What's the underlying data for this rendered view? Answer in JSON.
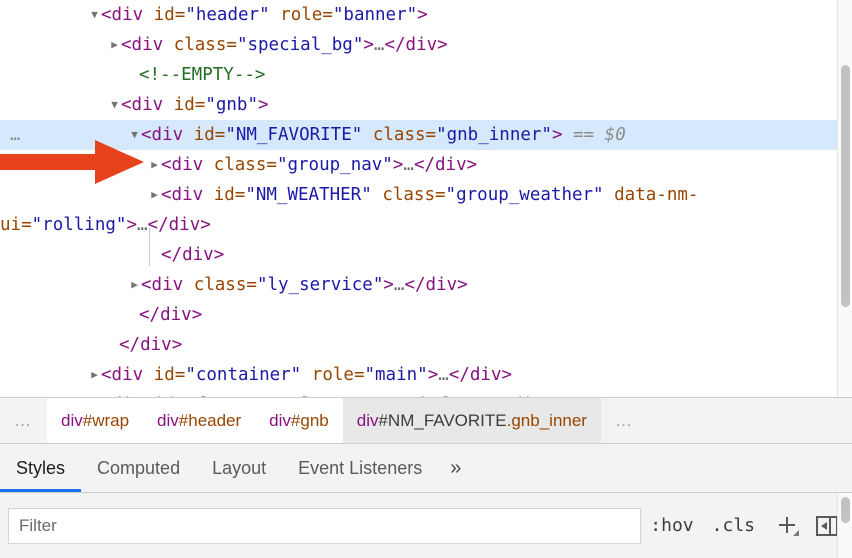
{
  "dom_tree": {
    "rows": [
      {
        "id": "header",
        "indent": 88,
        "twisty": "open",
        "parts": [
          {
            "t": "angle",
            "v": "<"
          },
          {
            "t": "tag",
            "v": "div"
          },
          {
            "t": "space",
            "v": " "
          },
          {
            "t": "attname",
            "v": "id"
          },
          {
            "t": "punct_eq",
            "v": "="
          },
          {
            "t": "attval",
            "v": "\"header\""
          },
          {
            "t": "space",
            "v": " "
          },
          {
            "t": "attname",
            "v": "role"
          },
          {
            "t": "punct_eq",
            "v": "="
          },
          {
            "t": "attval",
            "v": "\"banner\""
          },
          {
            "t": "angle",
            "v": ">"
          }
        ]
      },
      {
        "id": "special_bg",
        "indent": 108,
        "twisty": "closed",
        "parts": [
          {
            "t": "angle",
            "v": "<"
          },
          {
            "t": "tag",
            "v": "div"
          },
          {
            "t": "space",
            "v": " "
          },
          {
            "t": "attname",
            "v": "class"
          },
          {
            "t": "punct_eq",
            "v": "="
          },
          {
            "t": "attval",
            "v": "\"special_bg\""
          },
          {
            "t": "angle",
            "v": ">"
          },
          {
            "t": "ellip",
            "v": "…"
          },
          {
            "t": "angle",
            "v": "</"
          },
          {
            "t": "tag",
            "v": "div"
          },
          {
            "t": "angle",
            "v": ">"
          }
        ]
      },
      {
        "id": "empty_comment",
        "indent": 126,
        "twisty": "none",
        "parts": [
          {
            "t": "comment",
            "v": "<!--EMPTY-->"
          }
        ]
      },
      {
        "id": "gnb",
        "indent": 108,
        "twisty": "open",
        "parts": [
          {
            "t": "angle",
            "v": "<"
          },
          {
            "t": "tag",
            "v": "div"
          },
          {
            "t": "space",
            "v": " "
          },
          {
            "t": "attname",
            "v": "id"
          },
          {
            "t": "punct_eq",
            "v": "="
          },
          {
            "t": "attval",
            "v": "\"gnb\""
          },
          {
            "t": "angle",
            "v": ">"
          }
        ]
      },
      {
        "id": "NM_FAVORITE",
        "indent": 128,
        "twisty": "open",
        "selected": true,
        "gutter_dots": "…",
        "parts": [
          {
            "t": "angle",
            "v": "<"
          },
          {
            "t": "tag",
            "v": "div"
          },
          {
            "t": "space",
            "v": " "
          },
          {
            "t": "attname",
            "v": "id"
          },
          {
            "t": "punct_eq",
            "v": "="
          },
          {
            "t": "attval",
            "v": "\"NM_FAVORITE\""
          },
          {
            "t": "space",
            "v": " "
          },
          {
            "t": "attname",
            "v": "class"
          },
          {
            "t": "punct_eq",
            "v": "="
          },
          {
            "t": "attval",
            "v": "\"gnb_inner\""
          },
          {
            "t": "angle",
            "v": ">"
          },
          {
            "t": "space",
            "v": " "
          },
          {
            "t": "dollar",
            "v": "== $0"
          }
        ]
      },
      {
        "id": "group_nav",
        "indent": 148,
        "twisty": "closed",
        "parts": [
          {
            "t": "angle",
            "v": "<"
          },
          {
            "t": "tag",
            "v": "div"
          },
          {
            "t": "space",
            "v": " "
          },
          {
            "t": "attname",
            "v": "class"
          },
          {
            "t": "punct_eq",
            "v": "="
          },
          {
            "t": "attval",
            "v": "\"group_nav\""
          },
          {
            "t": "angle",
            "v": ">"
          },
          {
            "t": "ellip",
            "v": "…"
          },
          {
            "t": "angle",
            "v": "</"
          },
          {
            "t": "tag",
            "v": "div"
          },
          {
            "t": "angle",
            "v": ">"
          }
        ]
      },
      {
        "id": "NM_WEATHER",
        "indent": 148,
        "twisty": "closed",
        "wraps": true,
        "parts": [
          {
            "t": "angle",
            "v": "<"
          },
          {
            "t": "tag",
            "v": "div"
          },
          {
            "t": "space",
            "v": " "
          },
          {
            "t": "attname",
            "v": "id"
          },
          {
            "t": "punct_eq",
            "v": "="
          },
          {
            "t": "attval",
            "v": "\"NM_WEATHER\""
          },
          {
            "t": "space",
            "v": " "
          },
          {
            "t": "attname",
            "v": "class"
          },
          {
            "t": "punct_eq",
            "v": "="
          },
          {
            "t": "attval",
            "v": "\"group_weather\""
          },
          {
            "t": "space",
            "v": " "
          },
          {
            "t": "attname",
            "v": "data-nm-ui"
          },
          {
            "t": "punct_eq",
            "v": "="
          },
          {
            "t": "attval",
            "v": "\"rolling\""
          },
          {
            "t": "angle",
            "v": ">"
          },
          {
            "t": "ellip",
            "v": "…"
          },
          {
            "t": "angle",
            "v": "</"
          },
          {
            "t": "tag",
            "v": "div"
          },
          {
            "t": "angle",
            "v": ">"
          }
        ]
      },
      {
        "id": "close_gnb_inner",
        "indent": 148,
        "twisty": "none",
        "parts": [
          {
            "t": "angle",
            "v": "</"
          },
          {
            "t": "tag",
            "v": "div"
          },
          {
            "t": "angle",
            "v": ">"
          }
        ]
      },
      {
        "id": "ly_service",
        "indent": 128,
        "twisty": "closed",
        "parts": [
          {
            "t": "angle",
            "v": "<"
          },
          {
            "t": "tag",
            "v": "div"
          },
          {
            "t": "space",
            "v": " "
          },
          {
            "t": "attname",
            "v": "class"
          },
          {
            "t": "punct_eq",
            "v": "="
          },
          {
            "t": "attval",
            "v": "\"ly_service\""
          },
          {
            "t": "angle",
            "v": ">"
          },
          {
            "t": "ellip",
            "v": "…"
          },
          {
            "t": "angle",
            "v": "</"
          },
          {
            "t": "tag",
            "v": "div"
          },
          {
            "t": "angle",
            "v": ">"
          }
        ]
      },
      {
        "id": "close_gnb",
        "indent": 126,
        "twisty": "none",
        "parts": [
          {
            "t": "angle",
            "v": "</"
          },
          {
            "t": "tag",
            "v": "div"
          },
          {
            "t": "angle",
            "v": ">"
          }
        ]
      },
      {
        "id": "close_header",
        "indent": 106,
        "twisty": "none",
        "parts": [
          {
            "t": "angle",
            "v": "</"
          },
          {
            "t": "tag",
            "v": "div"
          },
          {
            "t": "angle",
            "v": ">"
          }
        ]
      },
      {
        "id": "container",
        "indent": 88,
        "twisty": "closed",
        "parts": [
          {
            "t": "angle",
            "v": "<"
          },
          {
            "t": "tag",
            "v": "div"
          },
          {
            "t": "space",
            "v": " "
          },
          {
            "t": "attname",
            "v": "id"
          },
          {
            "t": "punct_eq",
            "v": "="
          },
          {
            "t": "attval",
            "v": "\"container\""
          },
          {
            "t": "space",
            "v": " "
          },
          {
            "t": "attname",
            "v": "role"
          },
          {
            "t": "punct_eq",
            "v": "="
          },
          {
            "t": "attval",
            "v": "\"main\""
          },
          {
            "t": "angle",
            "v": ">"
          },
          {
            "t": "ellip",
            "v": "…"
          },
          {
            "t": "angle",
            "v": "</"
          },
          {
            "t": "tag",
            "v": "div"
          },
          {
            "t": "angle",
            "v": ">"
          }
        ]
      },
      {
        "id": "footer",
        "indent": 88,
        "twisty": "closed",
        "clipped": true,
        "parts": [
          {
            "t": "angle",
            "v": "<"
          },
          {
            "t": "tag",
            "v": "div"
          },
          {
            "t": "space",
            "v": " "
          },
          {
            "t": "attname",
            "v": "id"
          },
          {
            "t": "punct_eq",
            "v": "="
          },
          {
            "t": "attval",
            "v": "\"footer\""
          },
          {
            "t": "space",
            "v": " "
          },
          {
            "t": "attname",
            "v": "role"
          },
          {
            "t": "punct_eq",
            "v": "="
          },
          {
            "t": "attval",
            "v": "\"contentinfo\""
          },
          {
            "t": "angle",
            "v": ">"
          },
          {
            "t": "space",
            "v": " "
          },
          {
            "t": "angle",
            "v": "</"
          },
          {
            "t": "tag",
            "v": "div"
          },
          {
            "t": "angle",
            "v": ">"
          }
        ]
      }
    ]
  },
  "annotation": {
    "arrow_color": "#E8421C",
    "name": "red-arrow-pointing-to-group-nav"
  },
  "breadcrumb": {
    "overflow_left": "…",
    "overflow_right": "…",
    "items": [
      {
        "tag": "div",
        "id": "#wrap",
        "cls": "",
        "selected": false
      },
      {
        "tag": "div",
        "id": "#header",
        "cls": "",
        "selected": false
      },
      {
        "tag": "div",
        "id": "#gnb",
        "cls": "",
        "selected": false
      },
      {
        "tag": "div",
        "id": "#NM_FAVORITE",
        "cls": ".gnb_inner",
        "selected": true
      }
    ]
  },
  "tabs": {
    "items": [
      {
        "label": "Styles",
        "active": true
      },
      {
        "label": "Computed",
        "active": false
      },
      {
        "label": "Layout",
        "active": false
      },
      {
        "label": "Event Listeners",
        "active": false
      }
    ],
    "more_label": "»"
  },
  "toolbar": {
    "filter_placeholder": "Filter",
    "filter_value": "",
    "hov_label": ":hov",
    "cls_label": ".cls",
    "new_rule_label": "+",
    "sidebar_toggle_label": "toggle-sidebar"
  },
  "colors": {
    "selected_row_bg": "#d6e8fb",
    "tag": "#881280",
    "attr_name": "#994500",
    "attr_value": "#1a1aa6",
    "comment": "#236e25",
    "accent": "#1a73e8",
    "arrow": "#E8421C"
  }
}
